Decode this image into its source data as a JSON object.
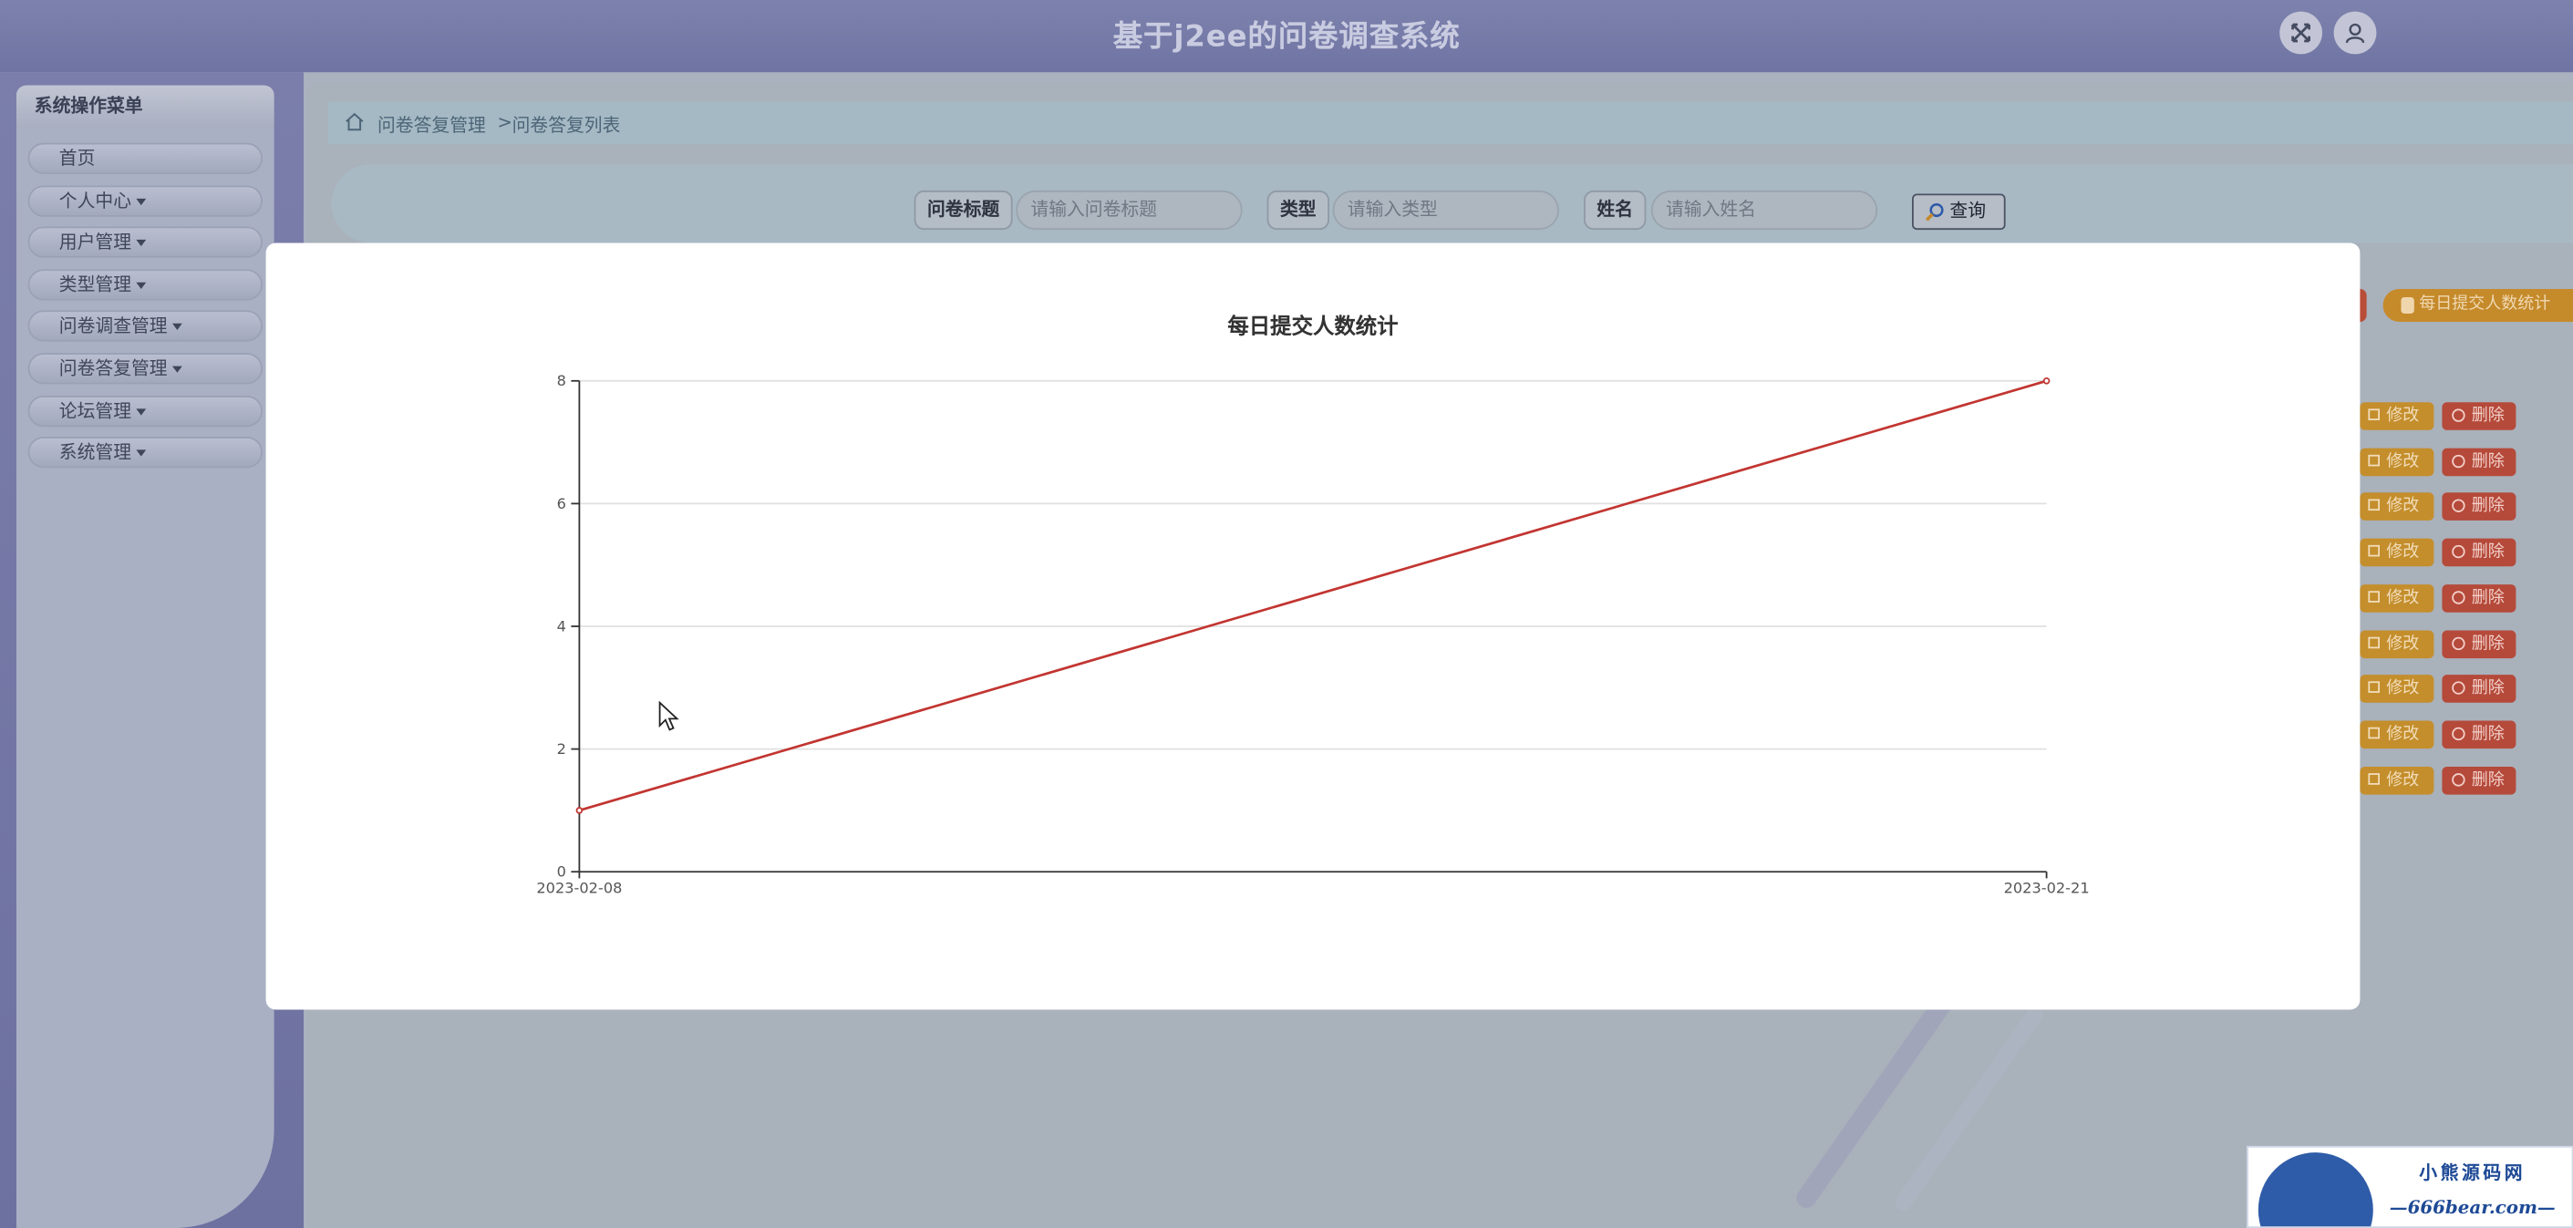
{
  "header": {
    "title": "基于j2ee的问卷调查系统",
    "fullscreen_icon": "fullscreen-icon",
    "user_icon": "user-icon"
  },
  "sidebar": {
    "title": "系统操作菜单",
    "items": [
      {
        "label": "首页",
        "dropdown": false
      },
      {
        "label": "个人中心",
        "dropdown": true
      },
      {
        "label": "用户管理",
        "dropdown": true
      },
      {
        "label": "类型管理",
        "dropdown": true
      },
      {
        "label": "问卷调查管理",
        "dropdown": true
      },
      {
        "label": "问卷答复管理",
        "dropdown": true
      },
      {
        "label": "论坛管理",
        "dropdown": true
      },
      {
        "label": "系统管理",
        "dropdown": true
      }
    ]
  },
  "breadcrumb": {
    "section": "问卷答复管理",
    "separator": ">",
    "page": "问卷答复列表"
  },
  "search": {
    "title_label": "问卷标题",
    "title_placeholder": "请输入问卷标题",
    "type_label": "类型",
    "type_placeholder": "请输入类型",
    "name_label": "姓名",
    "name_placeholder": "请输入姓名",
    "query_label": "查询"
  },
  "actions": {
    "stats_label": "每日提交人数统计",
    "edit_label": "修改",
    "delete_label": "删除",
    "row_count": 9
  },
  "watermark": {
    "title": "小熊源码网",
    "url": "—666bear.com—"
  },
  "chart_data": {
    "type": "line",
    "title": "每日提交人数统计",
    "x": [
      "2023-02-08",
      "2023-02-21"
    ],
    "series": [
      {
        "values": [
          1,
          8
        ]
      }
    ],
    "ylim": [
      0,
      8
    ],
    "yticks": [
      0,
      2,
      4,
      6,
      8
    ],
    "grid": true,
    "color": "#c23531"
  }
}
